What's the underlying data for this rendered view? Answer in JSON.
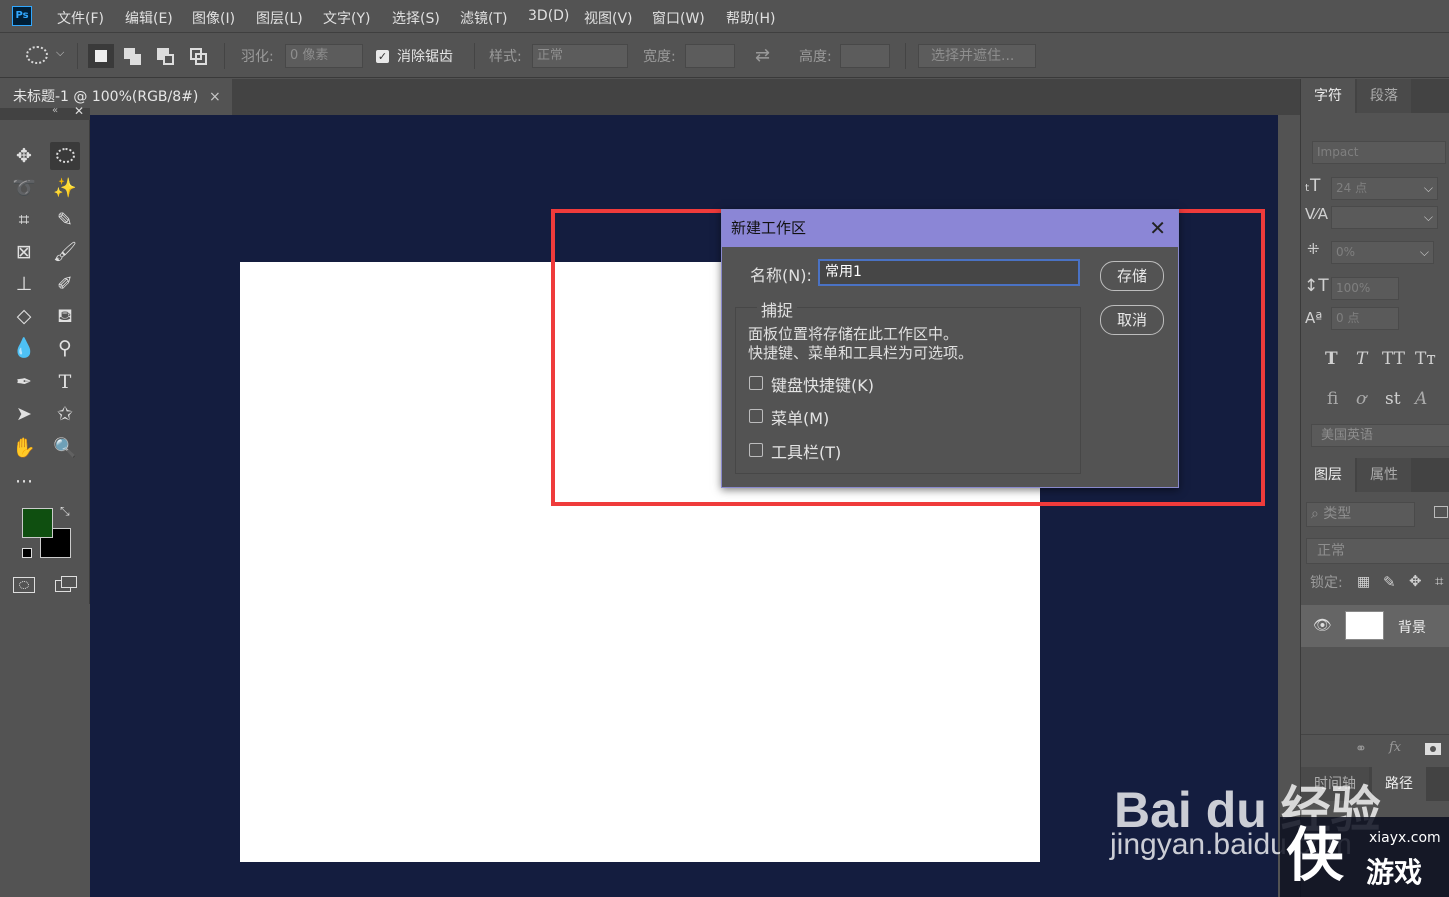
{
  "app": {
    "logo": "Ps"
  },
  "menu": [
    "文件(F)",
    "编辑(E)",
    "图像(I)",
    "图层(L)",
    "文字(Y)",
    "选择(S)",
    "滤镜(T)",
    "3D(D)",
    "视图(V)",
    "窗口(W)",
    "帮助(H)"
  ],
  "options": {
    "feather_label": "羽化:",
    "feather_value": "0 像素",
    "antialias_label": "消除锯齿",
    "style_label": "样式:",
    "style_value": "正常",
    "width_label": "宽度:",
    "height_label": "高度:",
    "select_mask_button": "选择并遮住..."
  },
  "document_tab": {
    "title": "未标题-1 @ 100%(RGB/8#)",
    "close": "×"
  },
  "colors": {
    "foreground": "#0f4f10",
    "background": "#000000",
    "canvas_bg": "#141d3f",
    "dialog_title": "#8b86d6",
    "highlight": "#ef3b3b"
  },
  "character_panel": {
    "tabs": [
      "字符",
      "段落"
    ],
    "font": "Impact",
    "size": "24 点",
    "tracking": "0%",
    "scale": "100%",
    "baseline": "0 点",
    "language": "美国英语"
  },
  "layers_panel": {
    "tabs": [
      "图层",
      "属性"
    ],
    "filter_kind": "类型",
    "blend_mode": "正常",
    "lock_label": "锁定:",
    "layer_name": "背景",
    "bottom_tabs": [
      "时间轴",
      "路径"
    ]
  },
  "dialog": {
    "title": "新建工作区",
    "name_label": "名称(N):",
    "name_value": "常用1",
    "capture_title": "捕捉",
    "description": [
      "面板位置将存储在此工作区中。",
      "快捷键、菜单和工具栏为可选项。"
    ],
    "options": [
      "键盘快捷键(K)",
      "菜单(M)",
      "工具栏(T)"
    ],
    "save_button": "存储",
    "cancel_button": "取消"
  },
  "watermark": {
    "brand": "Bai du 经验",
    "url": "jingyan.baidu.com",
    "site": "xiayx.com",
    "site_name": "游戏"
  }
}
